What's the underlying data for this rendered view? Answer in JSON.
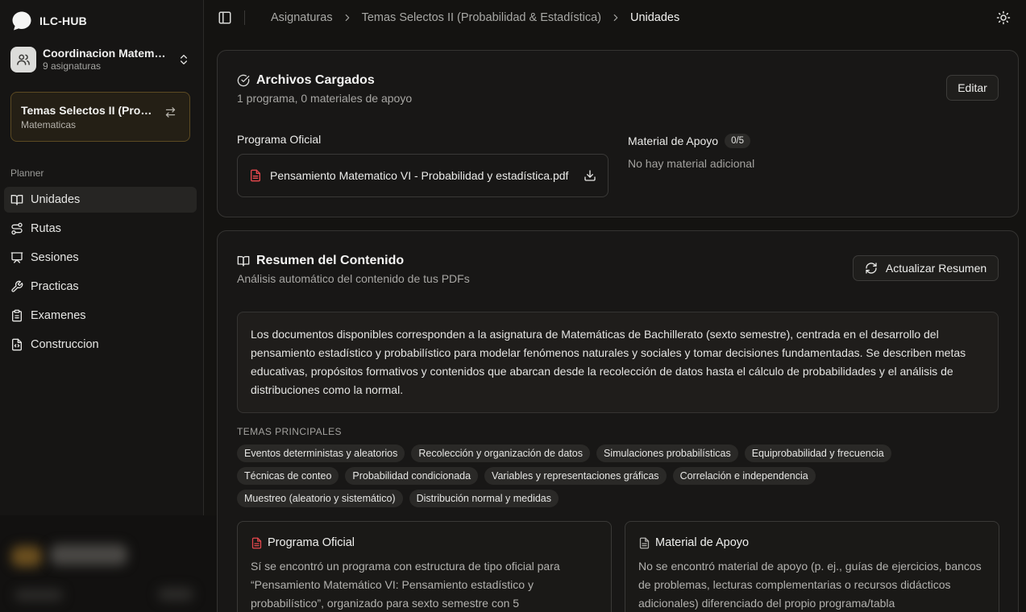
{
  "app": {
    "name": "ILC-HUB"
  },
  "workspace": {
    "title": "Coordinacion Matematicas",
    "subtitle": "9 asignaturas"
  },
  "course": {
    "title": "Temas Selectos II (Probabilidad & Estadística)",
    "subtitle": "Matematicas"
  },
  "sidebar": {
    "section_label": "Planner",
    "items": [
      {
        "label": "Unidades",
        "icon": "book-open-icon",
        "active": true
      },
      {
        "label": "Rutas",
        "icon": "route-icon"
      },
      {
        "label": "Sesiones",
        "icon": "presentation-icon"
      },
      {
        "label": "Practicas",
        "icon": "wrench-icon"
      },
      {
        "label": "Examenes",
        "icon": "clipboard-icon"
      },
      {
        "label": "Construccion",
        "icon": "file-code-icon"
      }
    ]
  },
  "breadcrumb": {
    "items": [
      "Asignaturas",
      "Temas Selectos II (Probabilidad & Estadística)"
    ],
    "current": "Unidades"
  },
  "files_card": {
    "title": "Archivos Cargados",
    "description": "1 programa, 0 materiales de apoyo",
    "edit_label": "Editar",
    "program_label": "Programa Oficial",
    "program_file": "Pensamiento Matematico VI - Probabilidad y estadística.pdf",
    "material_label": "Material de Apoyo",
    "material_count": "0/5",
    "material_empty": "No hay material adicional"
  },
  "summary_card": {
    "title": "Resumen del Contenido",
    "description": "Análisis automático del contenido de tus PDFs",
    "refresh_label": "Actualizar Resumen",
    "summary_text": "Los documentos disponibles corresponden a la asignatura de Matemáticas de Bachillerato (sexto semestre), centrada en el desarrollo del pensamiento estadístico y probabilístico para modelar fenómenos naturales y sociales y tomar decisiones fundamentadas. Se describen metas educativas, propósitos formativos y contenidos que abarcan desde la recolección de datos hasta el cálculo de probabilidades y el análisis de distribuciones como la normal.",
    "topics_label": "TEMAS PRINCIPALES",
    "topics": [
      [
        "Eventos deterministas y aleatorios",
        "Recolección y organización de datos",
        "Simulaciones probabilísticas",
        "Equiprobabilidad y frecuencia"
      ],
      [
        "Técnicas de conteo",
        "Probabilidad condicionada",
        "Variables y representaciones gráficas",
        "Correlación e independencia"
      ],
      [
        "Muestreo (aleatorio y sistemático)",
        "Distribución normal y medidas"
      ]
    ],
    "program_title": "Programa Oficial",
    "program_text": "Sí se encontró un programa con estructura de tipo oficial para “Pensamiento Matemático VI: Pensamiento estadístico y probabilístico”, organizado para sexto semestre con 5",
    "material_title": "Material de Apoyo",
    "material_text": "No se encontró material de apoyo (p. ej., guías de ejercicios, bancos de problemas, lecturas complementarias o recursos didácticos adicionales) diferenciado del propio programa/tabla"
  },
  "colors": {
    "accent_border": "#5c4a22",
    "pdf_icon": "#e5484d"
  }
}
